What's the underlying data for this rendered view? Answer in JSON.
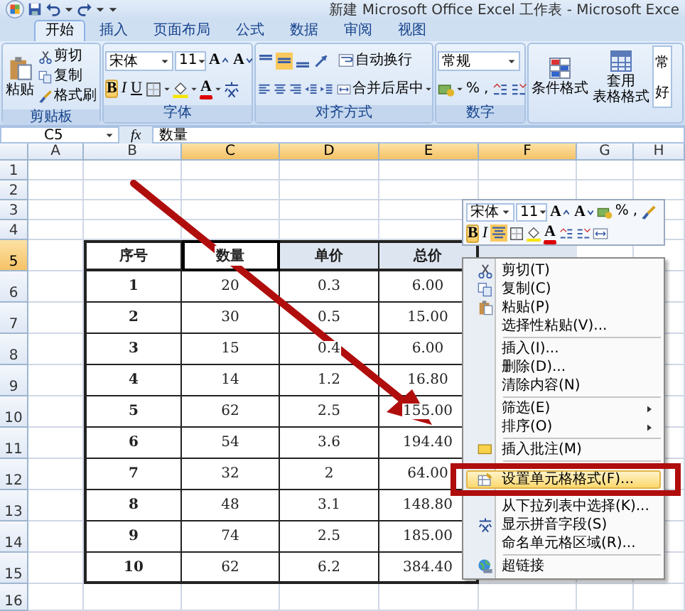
{
  "window": {
    "title": "新建 Microsoft Office Excel 工作表 - Microsoft Exce"
  },
  "tabs": [
    {
      "label": "开始",
      "selected": true
    },
    {
      "label": "插入",
      "selected": false
    },
    {
      "label": "页面布局",
      "selected": false
    },
    {
      "label": "公式",
      "selected": false
    },
    {
      "label": "数据",
      "selected": false
    },
    {
      "label": "审阅",
      "selected": false
    },
    {
      "label": "视图",
      "selected": false
    }
  ],
  "ribbon": {
    "clipboard": {
      "label": "剪贴板",
      "paste": "粘贴",
      "items": [
        {
          "kind": "cut",
          "label": "剪切"
        },
        {
          "kind": "copy",
          "label": "复制"
        },
        {
          "kind": "brush",
          "label": "格式刷"
        }
      ]
    },
    "font": {
      "label": "字体",
      "font": "宋体",
      "size": "11",
      "grow": "A",
      "shrink": "A",
      "styles": [
        {
          "label": "B",
          "selected": true
        },
        {
          "label": "I",
          "selected": false
        },
        {
          "label": "U",
          "selected": false
        }
      ],
      "font_color_label": "A"
    },
    "alignment": {
      "label": "对齐方式",
      "wrap": "自动换行",
      "merge": "合并后居中",
      "center_selected": true
    },
    "number": {
      "label": "数字",
      "format": "常规",
      "percent": "%",
      "comma": ","
    },
    "styles": {
      "conditional": "条件格式",
      "table": [
        "套用",
        "表格格式"
      ],
      "gallery": [
        "常",
        "好"
      ]
    }
  },
  "formula_bar": {
    "name_box": "C5",
    "fx": "fx",
    "value": "数量"
  },
  "sheet": {
    "columns": [
      {
        "label": "A",
        "selected": false
      },
      {
        "label": "B",
        "selected": false
      },
      {
        "label": "C",
        "selected": true
      },
      {
        "label": "D",
        "selected": true
      },
      {
        "label": "E",
        "selected": true
      },
      {
        "label": "F",
        "selected": true
      },
      {
        "label": "G",
        "selected": false
      },
      {
        "label": "H",
        "selected": false
      }
    ],
    "rows": [
      {
        "label": "1",
        "selected": false
      },
      {
        "label": "2",
        "selected": false
      },
      {
        "label": "3",
        "selected": false
      },
      {
        "label": "4",
        "selected": false
      },
      {
        "label": "5",
        "selected": true
      },
      {
        "label": "6",
        "selected": false
      },
      {
        "label": "7",
        "selected": false
      },
      {
        "label": "8",
        "selected": false
      },
      {
        "label": "9",
        "selected": false
      },
      {
        "label": "10",
        "selected": false
      },
      {
        "label": "11",
        "selected": false
      },
      {
        "label": "12",
        "selected": false
      },
      {
        "label": "13",
        "selected": false
      },
      {
        "label": "14",
        "selected": false
      },
      {
        "label": "15",
        "selected": false
      },
      {
        "label": "16",
        "selected": false
      }
    ],
    "table": {
      "header": [
        "序号",
        "数量",
        "单价",
        "总价"
      ],
      "rows": [
        [
          "1",
          "20",
          "0.3",
          "6.00"
        ],
        [
          "2",
          "30",
          "0.5",
          "15.00"
        ],
        [
          "3",
          "15",
          "0.4",
          "6.00"
        ],
        [
          "4",
          "14",
          "1.2",
          "16.80"
        ],
        [
          "5",
          "62",
          "2.5",
          "155.00"
        ],
        [
          "6",
          "54",
          "3.6",
          "194.40"
        ],
        [
          "7",
          "32",
          "2",
          "64.00"
        ],
        [
          "8",
          "48",
          "3.1",
          "148.80"
        ],
        [
          "9",
          "74",
          "2.5",
          "185.00"
        ],
        [
          "10",
          "62",
          "6.2",
          "384.40"
        ]
      ]
    }
  },
  "mini_toolbar": {
    "font": "宋体",
    "size": "11",
    "grow": "A",
    "shrink": "A",
    "percent": "%",
    "comma": ",",
    "bold": "B",
    "bold_selected": true,
    "italic": "I",
    "font_color_label": "A",
    "center_selected": true
  },
  "context_menu": [
    {
      "kind": "cut",
      "label": "剪切(T)",
      "selected": false
    },
    {
      "kind": "copy",
      "label": "复制(C)",
      "selected": false
    },
    {
      "kind": "paste",
      "label": "粘贴(P)",
      "selected": false
    },
    {
      "kind": "plain",
      "label": "选择性粘贴(V)...",
      "selected": false
    },
    {
      "kind": "separator"
    },
    {
      "kind": "plain",
      "label": "插入(I)...",
      "selected": false
    },
    {
      "kind": "plain",
      "label": "删除(D)...",
      "selected": false
    },
    {
      "kind": "plain",
      "label": "清除内容(N)",
      "selected": false
    },
    {
      "kind": "separator"
    },
    {
      "kind": "submenu",
      "label": "筛选(E)",
      "selected": false
    },
    {
      "kind": "submenu",
      "label": "排序(O)",
      "selected": false
    },
    {
      "kind": "separator"
    },
    {
      "kind": "comment",
      "label": "插入批注(M)",
      "selected": false
    },
    {
      "kind": "separator"
    },
    {
      "kind": "format",
      "label": "设置单元格格式(F)...",
      "selected": true
    },
    {
      "kind": "plain",
      "label": "从下拉列表中选择(K)...",
      "selected": false
    },
    {
      "kind": "phonetic",
      "label": "显示拼音字段(S)",
      "selected": false
    },
    {
      "kind": "plain",
      "label": "命名单元格区域(R)...",
      "selected": false
    },
    {
      "kind": "separator"
    },
    {
      "kind": "hyperlink",
      "label": "超链接",
      "selected": false
    }
  ]
}
